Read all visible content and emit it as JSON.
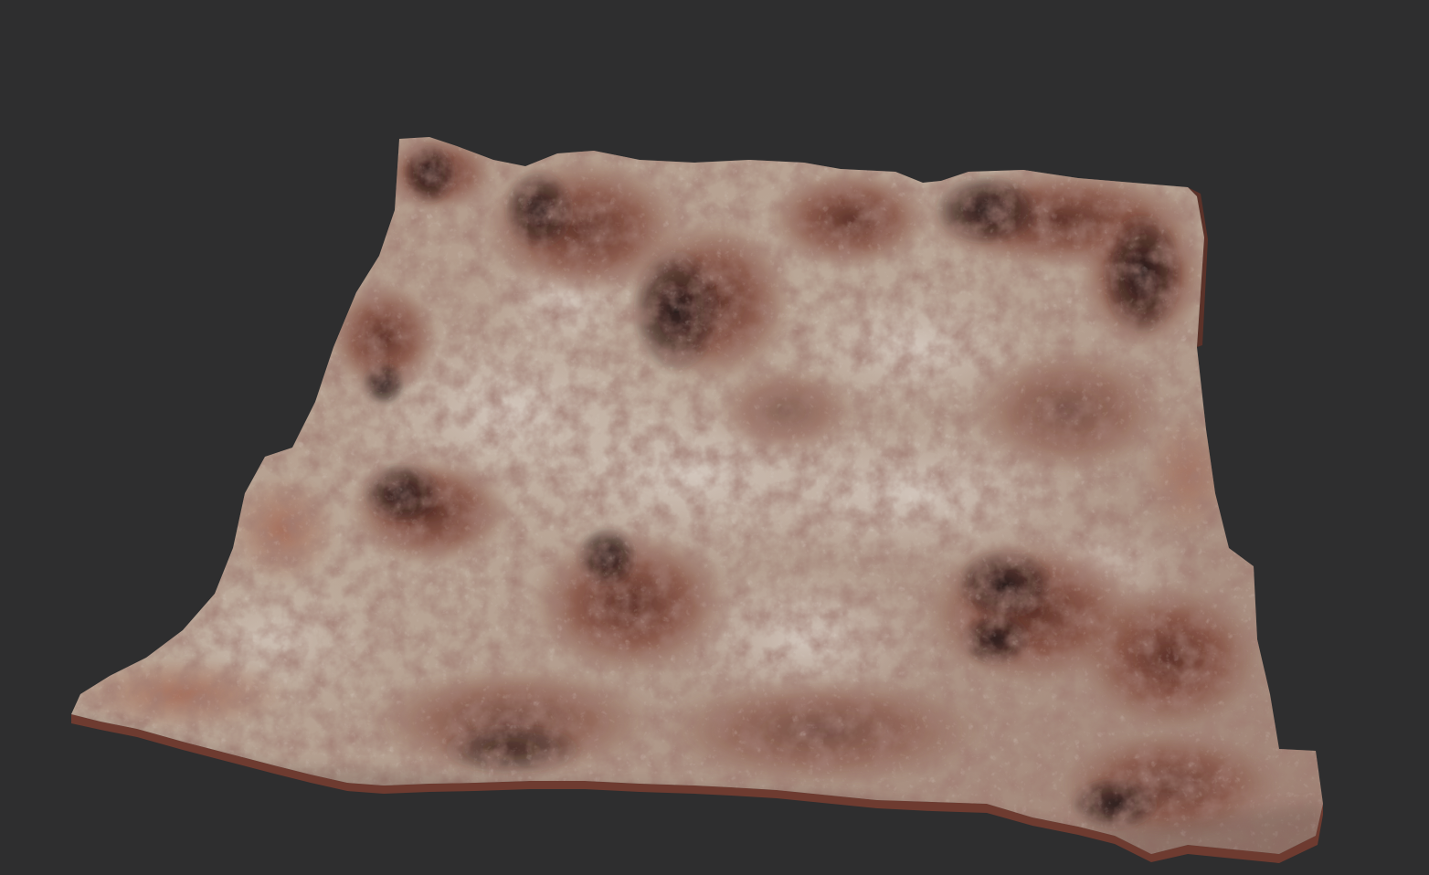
{
  "scene": {
    "background_color": "#2e2e2f",
    "subject": "terrain-heightmap-render",
    "palette": {
      "sand": "#b9a493",
      "pale_sand": "#cdbfb3",
      "rust": "#9a5a48",
      "red_rock": "#7d3f32",
      "shadow": "#3a2624",
      "deep_shadow": "#231716",
      "edge": "#8c5446"
    }
  }
}
